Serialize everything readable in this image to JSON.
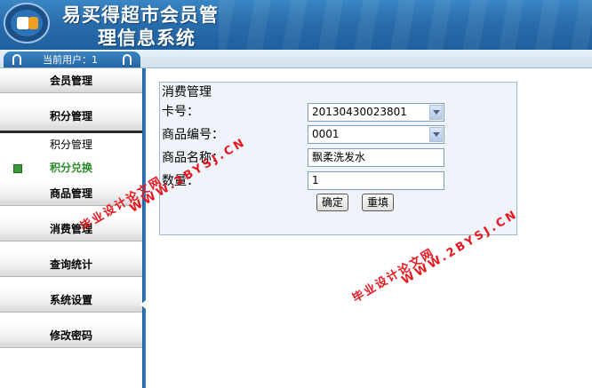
{
  "header": {
    "title_line1": "易买得超市会员管",
    "title_line2": "理信息系统"
  },
  "userbar": {
    "current_user": "当前用户：1"
  },
  "sidebar": {
    "items": [
      {
        "label": "会员管理"
      },
      {
        "label": "积分管理"
      },
      {
        "label": "商品管理"
      },
      {
        "label": "消费管理"
      },
      {
        "label": "查询统计"
      },
      {
        "label": "系统设置"
      },
      {
        "label": "修改密码"
      }
    ],
    "subitems": [
      {
        "label": "积分管理"
      },
      {
        "label": "积分兑换"
      }
    ]
  },
  "form": {
    "title": "消费管理",
    "card_label": "卡号：",
    "card_value": "20130430023801",
    "product_id_label": "商品编号：",
    "product_id_value": "0001",
    "product_name_label": "商品名称：",
    "product_name_value": "飘柔洗发水",
    "quantity_label": "数量：",
    "quantity_value": "1",
    "confirm_label": "确定",
    "reset_label": "重填"
  },
  "watermark": {
    "cn": "毕业设计论文网",
    "url": "WWW.2BYSJ.CN"
  },
  "colors": {
    "header_blue": "#2a6dac",
    "watermark_red": "#e8141e",
    "panel_bg": "#eef4fa"
  }
}
